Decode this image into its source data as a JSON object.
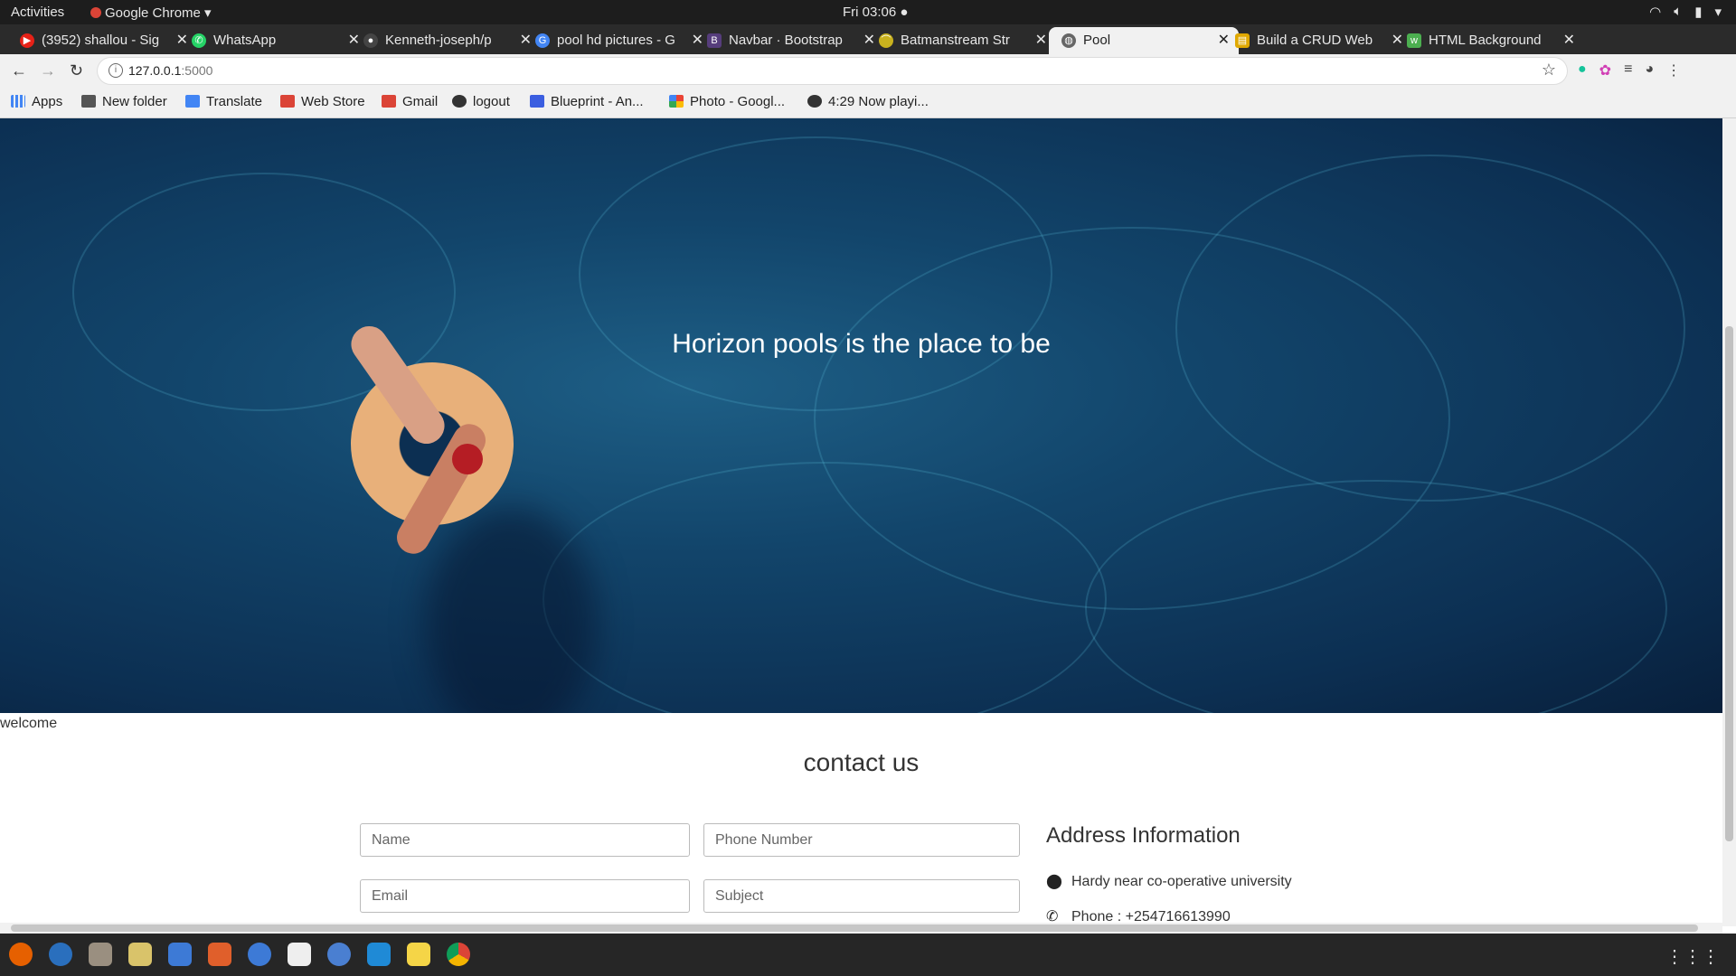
{
  "system_bar": {
    "activities": "Activities",
    "app_name": "Google Chrome ▾",
    "clock": "Fri 03:06 ●"
  },
  "tabs": [
    {
      "label": "(3952) shallou - Sig",
      "icon": "youtube-icon",
      "color": "#e62117"
    },
    {
      "label": "WhatsApp",
      "icon": "whatsapp-icon",
      "color": "#25d366"
    },
    {
      "label": "Kenneth-joseph/p",
      "icon": "github-icon",
      "color": "#444444"
    },
    {
      "label": "pool hd pictures - G",
      "icon": "google-icon",
      "color": "#4285f4"
    },
    {
      "label": "Navbar · Bootstrap",
      "icon": "bootstrap-icon",
      "color": "#563d7c"
    },
    {
      "label": "Batmanstream Str",
      "icon": "batman-icon",
      "color": "#c9b21e"
    },
    {
      "label": "Pool",
      "icon": "globe-icon",
      "color": "#666666",
      "active": true
    },
    {
      "label": "Build a CRUD Web",
      "icon": "article-icon",
      "color": "#e0a800"
    },
    {
      "label": "HTML Background",
      "icon": "w3schools-icon",
      "color": "#4caf50"
    }
  ],
  "address_bar": {
    "host": "127.0.0.1",
    "port": ":5000"
  },
  "bookmarks": [
    {
      "label": "Apps",
      "icon": "apps-grid-icon",
      "color": "#4285f4"
    },
    {
      "label": "New folder",
      "icon": "folder-icon",
      "color": "#555555"
    },
    {
      "label": "Translate",
      "icon": "translate-icon",
      "color": "#4285f4"
    },
    {
      "label": "Web Store",
      "icon": "webstore-icon",
      "color": "#db4437"
    },
    {
      "label": "Gmail",
      "icon": "gmail-icon",
      "color": "#db4437"
    },
    {
      "label": "logout",
      "icon": "globe-icon",
      "color": "#333333"
    },
    {
      "label": "Blueprint - An...",
      "icon": "blueprint-icon",
      "color": "#3b5ee0"
    },
    {
      "label": "Photo - Googl...",
      "icon": "photos-icon",
      "color": "#f4b400"
    },
    {
      "label": "4:29 Now playi...",
      "icon": "globe-icon",
      "color": "#333333"
    }
  ],
  "hero": {
    "title": "Horizon pools is the place to be"
  },
  "welcome_text": "welcome",
  "contact": {
    "title": "contact us",
    "name_placeholder": "Name",
    "phone_placeholder": "Phone Number",
    "email_placeholder": "Email",
    "subject_placeholder": "Subject"
  },
  "address": {
    "title": "Address Information",
    "location": "Hardy near co-operative university",
    "phone": "Phone : +254716613990"
  },
  "dock_apps": [
    {
      "name": "firefox-icon",
      "color": "#e66000"
    },
    {
      "name": "thunderbird-icon",
      "color": "#2a6fbd"
    },
    {
      "name": "files-icon",
      "color": "#9a8f80"
    },
    {
      "name": "camera-icon",
      "color": "#d9c36a"
    },
    {
      "name": "document-icon",
      "color": "#3d7ad6"
    },
    {
      "name": "software-icon",
      "color": "#e05f2b"
    },
    {
      "name": "help-icon",
      "color": "#3d7ad6"
    },
    {
      "name": "amazon-icon",
      "color": "#eeeeee"
    },
    {
      "name": "qbittorrent-icon",
      "color": "#4a7fd1"
    },
    {
      "name": "vscode-icon",
      "color": "#1f8ad6"
    },
    {
      "name": "notes-icon",
      "color": "#f5d547"
    },
    {
      "name": "chrome-icon",
      "color": "#db4437"
    }
  ]
}
